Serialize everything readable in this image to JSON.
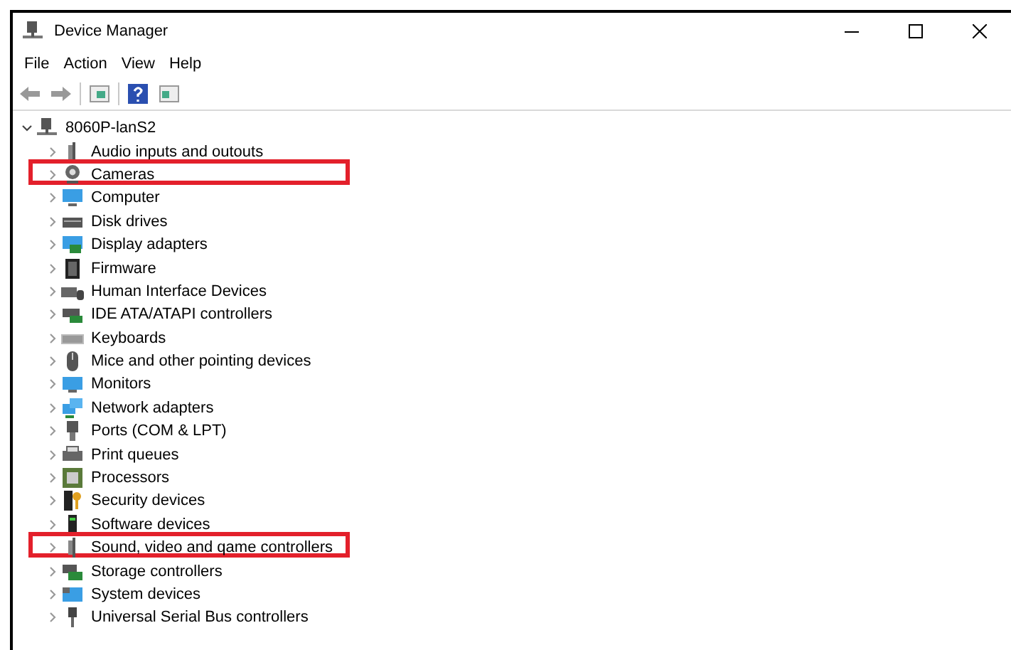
{
  "window": {
    "title": "Device Manager"
  },
  "menu": [
    "File",
    "Action",
    "View",
    "Help"
  ],
  "tree": {
    "label": "8060P-lanS2",
    "expanded": true,
    "children": [
      {
        "label": "Audio inputs and outouts",
        "expanded": false,
        "highlighted": false
      },
      {
        "label": "Cameras",
        "expanded": false,
        "highlighted": true
      },
      {
        "label": "Computer",
        "expanded": false,
        "highlighted": false
      },
      {
        "label": "Disk drives",
        "expanded": false,
        "highlighted": false
      },
      {
        "label": "Display adapters",
        "expanded": false,
        "highlighted": false
      },
      {
        "label": "Firmware",
        "expanded": false,
        "highlighted": false
      },
      {
        "label": "Human Interface Devices",
        "expanded": false,
        "highlighted": false
      },
      {
        "label": "IDE ATA/ATAPI controllers",
        "expanded": false,
        "highlighted": false
      },
      {
        "label": "Keyboards",
        "expanded": false,
        "highlighted": false
      },
      {
        "label": "Mice and other pointing devices",
        "expanded": false,
        "highlighted": false
      },
      {
        "label": "Monitors",
        "expanded": false,
        "highlighted": false
      },
      {
        "label": "Network adapters",
        "expanded": false,
        "highlighted": false
      },
      {
        "label": "Ports (COM & LPT)",
        "expanded": false,
        "highlighted": false
      },
      {
        "label": "Print queues",
        "expanded": false,
        "highlighted": false
      },
      {
        "label": "Processors",
        "expanded": false,
        "highlighted": false
      },
      {
        "label": "Security devices",
        "expanded": false,
        "highlighted": false
      },
      {
        "label": "Software devices",
        "expanded": false,
        "highlighted": false
      },
      {
        "label": "Sound, video and qame controllers",
        "expanded": false,
        "highlighted": true
      },
      {
        "label": "Storage controllers",
        "expanded": false,
        "highlighted": false
      },
      {
        "label": "System devices",
        "expanded": false,
        "highlighted": false
      },
      {
        "label": "Universal Serial Bus controllers",
        "expanded": false,
        "highlighted": false
      }
    ]
  }
}
